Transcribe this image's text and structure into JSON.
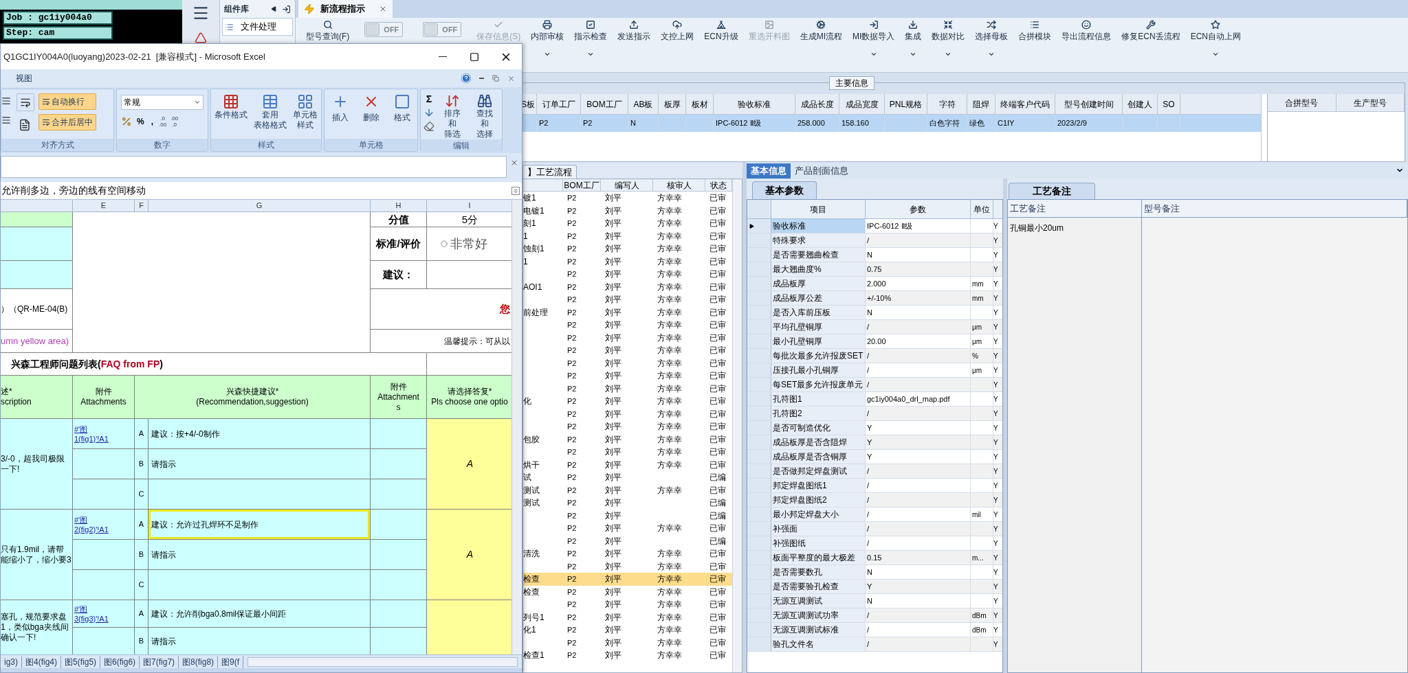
{
  "terminal": {
    "lines": [
      "Job : gc1iy004a0",
      "Step: cam"
    ]
  },
  "component_library": {
    "title": "组件库",
    "items": [
      "文件处理"
    ]
  },
  "tabs": [
    {
      "label": "新流程指示",
      "selected": true
    }
  ],
  "toolbar": [
    {
      "kind": "button",
      "label": "型号查询(F)",
      "disabled": false,
      "dropdown": false
    },
    {
      "kind": "toggle",
      "label": "OFF",
      "on": false
    },
    {
      "kind": "toggle",
      "label": "OFF",
      "on": false
    },
    {
      "kind": "button",
      "label": "保存信息(S)",
      "disabled": true,
      "dropdown": false
    },
    {
      "kind": "button",
      "label": "内部审核",
      "disabled": false,
      "dropdown": true
    },
    {
      "kind": "button",
      "label": "指示检查",
      "disabled": false,
      "dropdown": true
    },
    {
      "kind": "button",
      "label": "发送指示",
      "disabled": false,
      "dropdown": false
    },
    {
      "kind": "button",
      "label": "文控上网",
      "disabled": false,
      "dropdown": false
    },
    {
      "kind": "button",
      "label": "ECN升级",
      "disabled": false,
      "dropdown": false
    },
    {
      "kind": "button",
      "label": "重选开料图",
      "disabled": true,
      "dropdown": false
    },
    {
      "kind": "button",
      "label": "生成MI流程",
      "disabled": false,
      "dropdown": false
    },
    {
      "kind": "button",
      "label": "MI数据导入",
      "disabled": false,
      "dropdown": true
    },
    {
      "kind": "button",
      "label": "集成",
      "disabled": false,
      "dropdown": true
    },
    {
      "kind": "button",
      "label": "数据对比",
      "disabled": false,
      "dropdown": true
    },
    {
      "kind": "button",
      "label": "选择母板",
      "disabled": false,
      "dropdown": true
    },
    {
      "kind": "button",
      "label": "合拼模块",
      "disabled": false,
      "dropdown": false
    },
    {
      "kind": "button",
      "label": "导出流程信息",
      "disabled": false,
      "dropdown": false
    },
    {
      "kind": "button",
      "label": "修复ECN丢流程",
      "disabled": false,
      "dropdown": false
    },
    {
      "kind": "button",
      "label": "ECN自动上网",
      "disabled": false,
      "dropdown": true
    }
  ],
  "main_info": {
    "title": "主要信息",
    "columns": [
      "S板",
      "订单工厂",
      "BOM工厂",
      "AB板",
      "板厚",
      "板材",
      "验收标准",
      "成品长度",
      "成品宽度",
      "PNL规格",
      "字符",
      "阻焊",
      "终端客户代码",
      "型号创建时间",
      "创建人",
      "SO"
    ],
    "rows": [
      {
        "selected": true,
        "cells": [
          null,
          "P2",
          "P2",
          "N",
          null,
          null,
          "IPC-6012 Ⅱ级",
          "258.000",
          "158.160",
          null,
          "白色字符",
          "绿色",
          "C1IY",
          "2023/2/9",
          null,
          null
        ]
      }
    ],
    "side_columns": [
      "合拼型号",
      "生产型号"
    ]
  },
  "process_flow": {
    "tab": "】工艺流程",
    "columns": [
      "BOM工厂",
      "编写人",
      "核审人",
      "状态"
    ],
    "rows": [
      {
        "name": "镀1",
        "bom": "P2",
        "writer": "刘平",
        "reviewer": "方幸幸",
        "status": "已审",
        "selected": false
      },
      {
        "name": "电镀1",
        "bom": "P2",
        "writer": "刘平",
        "reviewer": "方幸幸",
        "status": "已审",
        "selected": false
      },
      {
        "name": "刻1",
        "bom": "P2",
        "writer": "刘平",
        "reviewer": "方幸幸",
        "status": "已审",
        "selected": false
      },
      {
        "name": "1",
        "bom": "P2",
        "writer": "刘平",
        "reviewer": "方幸幸",
        "status": "已审",
        "selected": false
      },
      {
        "name": "蚀刻1",
        "bom": "P2",
        "writer": "刘平",
        "reviewer": "方幸幸",
        "status": "已审",
        "selected": false
      },
      {
        "name": "1",
        "bom": "P2",
        "writer": "刘平",
        "reviewer": "方幸幸",
        "status": "已审",
        "selected": false
      },
      {
        "name": null,
        "bom": "P2",
        "writer": "刘平",
        "reviewer": "方幸幸",
        "status": "已审",
        "selected": false
      },
      {
        "name": "AOI1",
        "bom": "P2",
        "writer": "刘平",
        "reviewer": "方幸幸",
        "status": "已审",
        "selected": false
      },
      {
        "name": null,
        "bom": "P2",
        "writer": "刘平",
        "reviewer": "方幸幸",
        "status": "已审",
        "selected": false
      },
      {
        "name": "前处理",
        "bom": "P2",
        "writer": "刘平",
        "reviewer": "方幸幸",
        "status": "已审",
        "selected": false
      },
      {
        "name": null,
        "bom": "P2",
        "writer": "刘平",
        "reviewer": "方幸幸",
        "status": "已审",
        "selected": false
      },
      {
        "name": null,
        "bom": "P2",
        "writer": "刘平",
        "reviewer": "方幸幸",
        "status": "已审",
        "selected": false
      },
      {
        "name": null,
        "bom": "P2",
        "writer": "刘平",
        "reviewer": "方幸幸",
        "status": "已审",
        "selected": false
      },
      {
        "name": null,
        "bom": "P2",
        "writer": "刘平",
        "reviewer": "方幸幸",
        "status": "已审",
        "selected": false
      },
      {
        "name": null,
        "bom": "P2",
        "writer": "刘平",
        "reviewer": "方幸幸",
        "status": "已审",
        "selected": false
      },
      {
        "name": null,
        "bom": "P2",
        "writer": "刘平",
        "reviewer": "方幸幸",
        "status": "已审",
        "selected": false
      },
      {
        "name": "化",
        "bom": "P2",
        "writer": "刘平",
        "reviewer": "方幸幸",
        "status": "已审",
        "selected": false
      },
      {
        "name": null,
        "bom": "P2",
        "writer": "刘平",
        "reviewer": "方幸幸",
        "status": "已审",
        "selected": false
      },
      {
        "name": null,
        "bom": "P2",
        "writer": "刘平",
        "reviewer": "方幸幸",
        "status": "已审",
        "selected": false
      },
      {
        "name": "包胶",
        "bom": "P2",
        "writer": "刘平",
        "reviewer": "方幸幸",
        "status": "已审",
        "selected": false
      },
      {
        "name": null,
        "bom": "P2",
        "writer": "刘平",
        "reviewer": "方幸幸",
        "status": "已审",
        "selected": false
      },
      {
        "name": "烘干",
        "bom": "P2",
        "writer": "刘平",
        "reviewer": "方幸幸",
        "status": "已审",
        "selected": false
      },
      {
        "name": "试",
        "bom": "P2",
        "writer": "刘平",
        "reviewer": null,
        "status": "已编",
        "selected": false
      },
      {
        "name": "测试",
        "bom": "P2",
        "writer": "刘平",
        "reviewer": "方幸幸",
        "status": "已审",
        "selected": false
      },
      {
        "name": "测试",
        "bom": "P2",
        "writer": "刘平",
        "reviewer": null,
        "status": "已编",
        "selected": false
      },
      {
        "name": null,
        "bom": "P2",
        "writer": "刘平",
        "reviewer": null,
        "status": "已编",
        "selected": false
      },
      {
        "name": null,
        "bom": "P2",
        "writer": "刘平",
        "reviewer": "方幸幸",
        "status": "已审",
        "selected": false
      },
      {
        "name": null,
        "bom": "P2",
        "writer": "刘平",
        "reviewer": null,
        "status": "已编",
        "selected": false
      },
      {
        "name": "清洗",
        "bom": "P2",
        "writer": "刘平",
        "reviewer": "方幸幸",
        "status": "已审",
        "selected": false
      },
      {
        "name": null,
        "bom": "P2",
        "writer": "刘平",
        "reviewer": "方幸幸",
        "status": "已审",
        "selected": false
      },
      {
        "name": "检查",
        "bom": "P2",
        "writer": "刘平",
        "reviewer": "方幸幸",
        "status": "已审",
        "selected": true
      },
      {
        "name": "检查",
        "bom": "P2",
        "writer": "刘平",
        "reviewer": "方幸幸",
        "status": "已审",
        "selected": false
      },
      {
        "name": null,
        "bom": "P2",
        "writer": "刘平",
        "reviewer": "方幸幸",
        "status": "已审",
        "selected": false
      },
      {
        "name": "列号1",
        "bom": "P2",
        "writer": "刘平",
        "reviewer": "方幸幸",
        "status": "已审",
        "selected": false
      },
      {
        "name": "化1",
        "bom": "P2",
        "writer": "刘平",
        "reviewer": "方幸幸",
        "status": "已审",
        "selected": false
      },
      {
        "name": null,
        "bom": "P2",
        "writer": "刘平",
        "reviewer": "方幸幸",
        "status": "已审",
        "selected": false
      },
      {
        "name": "检查1",
        "bom": "P2",
        "writer": "刘平",
        "reviewer": "方幸幸",
        "status": "已审",
        "selected": false
      }
    ]
  },
  "basic_info": {
    "tabs": [
      {
        "label": "基本信息",
        "selected": true
      },
      {
        "label": "产品剖面信息",
        "selected": false
      }
    ],
    "subtab": "基本参数",
    "columns": [
      "项目",
      "参数",
      "单位"
    ],
    "rows": [
      {
        "item": "验收标准",
        "value": "IPC-6012 Ⅱ级",
        "unit": null,
        "column_4": "Y",
        "selected": true
      },
      {
        "item": "特殊要求",
        "value": "/",
        "unit": null,
        "column_4": "Y",
        "selected": false
      },
      {
        "item": "是否需要翘曲检查",
        "value": "N",
        "unit": null,
        "column_4": "Y",
        "selected": false
      },
      {
        "item": "最大翘曲度%",
        "value": "0.75",
        "unit": null,
        "column_4": "Y",
        "selected": false
      },
      {
        "item": "成品板厚",
        "value": "2.000",
        "unit": "mm",
        "column_4": "Y",
        "selected": false
      },
      {
        "item": "成品板厚公差",
        "value": "+/-10%",
        "unit": "mm",
        "column_4": "Y",
        "selected": false
      },
      {
        "item": "是否入库前压板",
        "value": "N",
        "unit": null,
        "column_4": "Y",
        "selected": false
      },
      {
        "item": "平均孔壁铜厚",
        "value": "/",
        "unit": "μm",
        "column_4": "Y",
        "selected": false
      },
      {
        "item": "最小孔壁铜厚",
        "value": "20.00",
        "unit": "μm",
        "column_4": "Y",
        "selected": false
      },
      {
        "item": "每批次最多允许报废SET",
        "value": "/",
        "unit": "%",
        "column_4": "Y",
        "selected": false
      },
      {
        "item": "压接孔最小孔铜厚",
        "value": "/",
        "unit": "μm",
        "column_4": "Y",
        "selected": false
      },
      {
        "item": "每SET最多允许报废单元",
        "value": "/",
        "unit": null,
        "column_4": "Y",
        "selected": false
      },
      {
        "item": "孔符图1",
        "value": "gc1iy004a0_drl_map.pdf",
        "unit": null,
        "column_4": "Y",
        "selected": false
      },
      {
        "item": "孔符图2",
        "value": "/",
        "unit": null,
        "column_4": "Y",
        "selected": false
      },
      {
        "item": "是否可制造优化",
        "value": "Y",
        "unit": null,
        "column_4": "Y",
        "selected": false
      },
      {
        "item": "成品板厚是否含阻焊",
        "value": "Y",
        "unit": null,
        "column_4": "Y",
        "selected": false
      },
      {
        "item": "成品板厚是否含铜厚",
        "value": "Y",
        "unit": null,
        "column_4": "Y",
        "selected": false
      },
      {
        "item": "是否做邦定焊盘测试",
        "value": "/",
        "unit": null,
        "column_4": "Y",
        "selected": false
      },
      {
        "item": "邦定焊盘图纸1",
        "value": "/",
        "unit": null,
        "column_4": "Y",
        "selected": false
      },
      {
        "item": "邦定焊盘图纸2",
        "value": "/",
        "unit": null,
        "column_4": "Y",
        "selected": false
      },
      {
        "item": "最小邦定焊盘大小",
        "value": "/",
        "unit": "mil",
        "column_4": "Y",
        "selected": false
      },
      {
        "item": "补强面",
        "value": "/",
        "unit": null,
        "column_4": "Y",
        "selected": false
      },
      {
        "item": "补强图纸",
        "value": "/",
        "unit": null,
        "column_4": "Y",
        "selected": false
      },
      {
        "item": "板面平整度的最大极差",
        "value": "0.15",
        "unit": "m...",
        "column_4": "Y",
        "selected": false
      },
      {
        "item": "是否需要数孔",
        "value": "N",
        "unit": null,
        "column_4": "Y",
        "selected": false
      },
      {
        "item": "是否需要验孔检查",
        "value": "Y",
        "unit": null,
        "column_4": "Y",
        "selected": false
      },
      {
        "item": "无源互调测试",
        "value": "N",
        "unit": null,
        "column_4": "Y",
        "selected": false
      },
      {
        "item": "无源互调测试功率",
        "value": "/",
        "unit": "dBm",
        "column_4": "Y",
        "selected": false
      },
      {
        "item": "无源互调测试标准",
        "value": "/",
        "unit": "dBm",
        "column_4": "Y",
        "selected": false
      },
      {
        "item": "验孔文件名",
        "value": "/",
        "unit": null,
        "column_4": "Y",
        "selected": false
      }
    ]
  },
  "remarks": {
    "tab": "工艺备注",
    "columns": [
      "工艺备注",
      "型号备注"
    ],
    "process_remark": "孔铜最小20um"
  },
  "excel": {
    "title": "Q1GC1IY004A0(luoyang)2023-02-21  [兼容模式] - Microsoft Excel",
    "menu": [
      "视图"
    ],
    "ribbon": {
      "alignment": {
        "label": "对齐方式",
        "buttons": [
          {
            "label": "自动换行",
            "highlighted": true
          },
          {
            "label": "合并后居中",
            "highlighted": true
          }
        ]
      },
      "number": {
        "label": "数字",
        "format": "常规",
        "symbols": [
          "%",
          ","
        ],
        "decimals": [
          {
            "top": ".0",
            "bottom": ".00"
          },
          {
            "top": ".00",
            "bottom": ".0"
          }
        ]
      },
      "styles": {
        "label": "样式",
        "buttons": [
          [
            "条件格式"
          ],
          [
            "套用",
            "表格格式"
          ],
          [
            "单元格",
            "样式"
          ]
        ]
      },
      "cells": {
        "label": "单元格",
        "buttons": [
          "插入",
          "删除",
          "格式"
        ]
      },
      "editing": {
        "label": "编辑",
        "sum": "Σ",
        "buttons": [
          [
            "排序和",
            "筛选"
          ],
          [
            "查找和",
            "选择"
          ]
        ]
      }
    },
    "cell_text": "允许削多边，旁边的线有空间移动",
    "columns": [
      "E",
      "F",
      "G",
      "H",
      "I"
    ],
    "sheet": {
      "score_label": "分值",
      "score": "5分",
      "rating_label": "标准/评价",
      "rating": "非常好",
      "rating_selected": false,
      "suggestion_label": "建议：",
      "form_code": "）（QR-ME-04(B)",
      "red_mark": "您",
      "note": "umn yellow area)",
      "hint": "温馨提示：可从以",
      "list_title": "兴森工程师问题列表(**FAQ from FP**)",
      "headers": [
        [
          "述*",
          "scription"
        ],
        [
          "附件",
          "Attachments"
        ],
        [
          "兴森快捷建议*",
          "(Recommendation,suggestion)"
        ],
        [
          "附件",
          "Attachment",
          "s"
        ],
        [
          "请选择答复*",
          "Pls choose one optio"
        ]
      ],
      "questions": [
        {
          "description": [
            "3/-0，超我司极限",
            "一下!"
          ],
          "link": [
            "#'图",
            "1(fig1)'!A1"
          ],
          "options": [
            {
              "letter": "A",
              "text": "建议：按+4/-0制作",
              "highlighted": false
            },
            {
              "letter": "B",
              "text": "请指示",
              "highlighted": false
            },
            {
              "letter": "C",
              "highlighted": false
            }
          ],
          "answer": "A"
        },
        {
          "description": [
            "只有1.9mil，请帮",
            "能缩小了，缩小要3"
          ],
          "link": [
            "#'图",
            "2(fig2)'!A1"
          ],
          "options": [
            {
              "letter": "A",
              "text": "建议：允许过孔焊环不足制作",
              "highlighted": true
            },
            {
              "letter": "B",
              "text": "请指示",
              "highlighted": false
            },
            {
              "letter": "C",
              "highlighted": false
            }
          ],
          "answer": "A"
        },
        {
          "description": [
            "塞孔，规范要求盘",
            "1，类似bga夹线间",
            "确认一下!"
          ],
          "link": [
            "#'图",
            "3(fig3)'!A1"
          ],
          "options": [
            {
              "letter": "A",
              "text": "建议：允许削bga0.8mil保证最小间距",
              "highlighted": false
            },
            {
              "letter": "B",
              "text": "请指示",
              "highlighted": false
            }
          ]
        }
      ]
    },
    "sheet_tabs": [
      "ig3)",
      "图4(fig4)",
      "图5(fig5)",
      "图6(fig6)",
      "图7(fig7)",
      "图8(fig8)",
      "图9(f"
    ]
  }
}
